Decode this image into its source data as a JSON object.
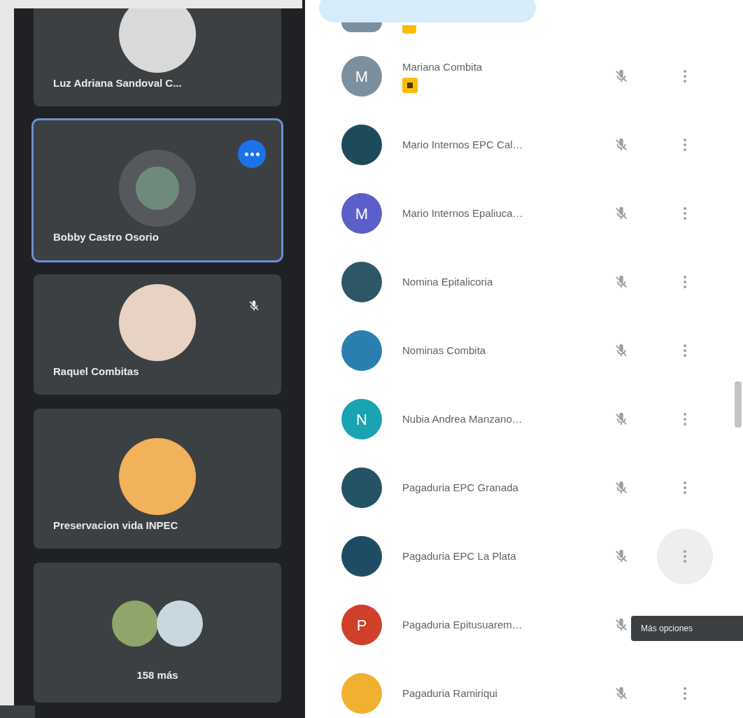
{
  "tiles": [
    {
      "kind": "person",
      "name": "Luz Adriana Sandoval C...",
      "avatar": {
        "color": "#d9d9d9"
      },
      "selected": false
    },
    {
      "kind": "person",
      "name": "Bobby Castro Osorio",
      "avatar": {
        "color": "#6f8a7a"
      },
      "selected": true,
      "speaking": true,
      "muted": false
    },
    {
      "kind": "person",
      "name": "Raquel Combitas",
      "avatar": {
        "color": "#e7d2c4"
      },
      "selected": false,
      "speaking": false,
      "muted": true
    },
    {
      "kind": "person",
      "name": "Preservacion vida INPEC",
      "avatar": {
        "color": "#f2b25a"
      },
      "selected": false,
      "speaking": false,
      "muted": false
    },
    {
      "kind": "overflow",
      "name": "158 más",
      "avatars": [
        {
          "color": "#8fa66a"
        },
        {
          "color": "#c8d8e0"
        }
      ]
    }
  ],
  "participants": [
    {
      "name": "Mariana Combita",
      "avatar": {
        "kind": "letter",
        "letter": "M",
        "color": "#7b8f9e"
      },
      "badge": true,
      "muted": true,
      "hovered": false
    },
    {
      "name": "Mario Internos EPC Cal…",
      "avatar": {
        "kind": "photo",
        "color": "#1e4b5a"
      },
      "badge": false,
      "muted": true,
      "hovered": false
    },
    {
      "name": "Mario Internos Epaliuca…",
      "avatar": {
        "kind": "letter",
        "letter": "M",
        "color": "#5c5fc9"
      },
      "badge": false,
      "muted": true,
      "hovered": false
    },
    {
      "name": "Nomina Epitalicoria",
      "avatar": {
        "kind": "photo",
        "color": "#2e5766"
      },
      "badge": false,
      "muted": true,
      "hovered": false
    },
    {
      "name": "Nominas Combita",
      "avatar": {
        "kind": "photo",
        "color": "#2a7fb0"
      },
      "badge": false,
      "muted": true,
      "hovered": false
    },
    {
      "name": "Nubia Andrea Manzano…",
      "avatar": {
        "kind": "letter",
        "letter": "N",
        "color": "#1aa3b0"
      },
      "badge": false,
      "muted": true,
      "hovered": false
    },
    {
      "name": "Pagaduria EPC Granada",
      "avatar": {
        "kind": "photo",
        "color": "#245366"
      },
      "badge": false,
      "muted": true,
      "hovered": false
    },
    {
      "name": "Pagaduria EPC La Plata",
      "avatar": {
        "kind": "photo",
        "color": "#1e4d63"
      },
      "badge": false,
      "muted": true,
      "hovered": true
    },
    {
      "name": "Pagaduria Epitusuarem…",
      "avatar": {
        "kind": "letter",
        "letter": "P",
        "color": "#d0402a"
      },
      "badge": false,
      "muted": true,
      "hovered": false
    },
    {
      "name": "Pagaduria Ramiriqui",
      "avatar": {
        "kind": "photo",
        "color": "#f0b030"
      },
      "badge": false,
      "muted": true,
      "hovered": false
    }
  ],
  "tooltip": "Más opciones"
}
